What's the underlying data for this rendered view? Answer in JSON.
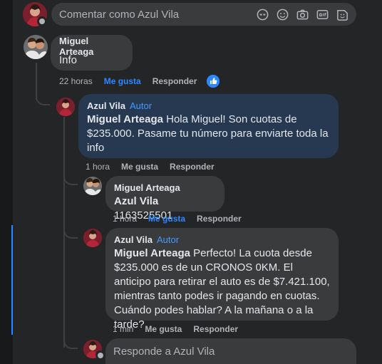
{
  "composer": {
    "placeholder": "Comentar como Azul Vila",
    "tools": [
      "emoji-icon",
      "smiley-icon",
      "camera-icon",
      "gif-icon",
      "sticker-icon"
    ]
  },
  "comment": {
    "author": "Miguel Arteaga",
    "text": "Info",
    "time": "22 horas",
    "like": "Me gusta",
    "reply": "Responder"
  },
  "replies": [
    {
      "author": "Azul Vila",
      "badge": "Autor",
      "mention": "Miguel Arteaga",
      "text": " Hola Miguel! Son cuotas de $235.000. Pasame tu número para enviarte toda la info",
      "time": "1 hora",
      "like": "Me gusta",
      "reply": "Responder"
    },
    {
      "author": "Miguel Arteaga",
      "mention": "Azul Vila",
      "text": " 1163525501",
      "time": "1 hora",
      "like": "Me gusta",
      "reply": "Responder"
    },
    {
      "author": "Azul Vila",
      "badge": "Autor",
      "mention": "Miguel Arteaga",
      "text": " Perfecto! La cuota desde $235.000 es de un CRONOS 0KM. El anticipo para retirar el auto es de $7.421.100, mientras tanto podes ir pagando en cuotas. Cuándo podes hablar? A la mañana o a la tarde?",
      "time": "1 min",
      "like": "Me gusta",
      "reply": "Responder"
    }
  ],
  "reply_box": {
    "placeholder": "Responde a Azul Vila"
  },
  "colors": {
    "accent": "#2d88ff",
    "author_bubble": "#263951",
    "bubble": "#3a3b3c",
    "badge": "#4599ff"
  }
}
